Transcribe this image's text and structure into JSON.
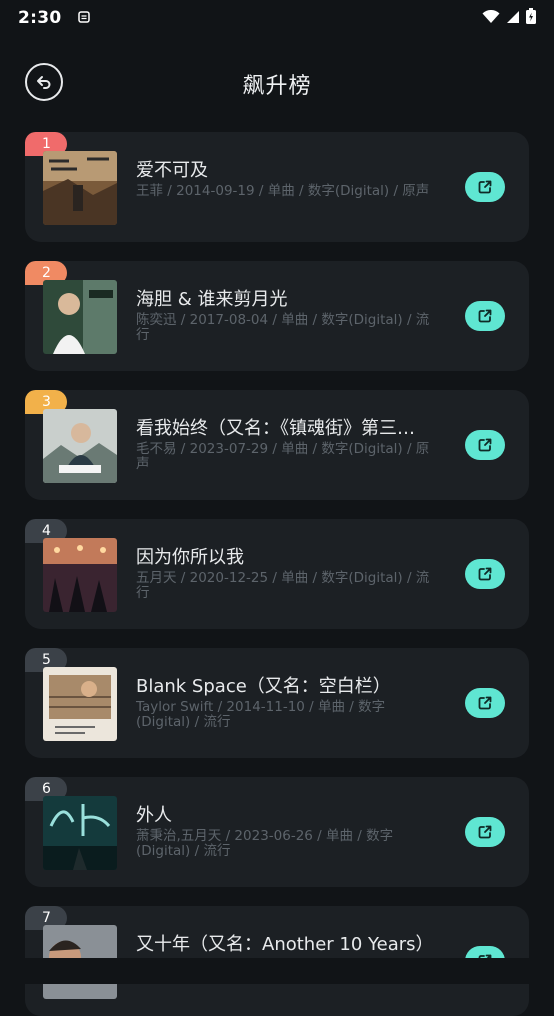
{
  "status": {
    "time": "2:30"
  },
  "header": {
    "title": "飙升榜"
  },
  "songs": [
    {
      "rank": "1",
      "title": "爱不可及",
      "meta": "王菲 / 2014-09-19 / 单曲 / 数字(Digital) / 原声"
    },
    {
      "rank": "2",
      "title": "海胆 & 谁来剪月光",
      "meta": "陈奕迅 / 2017-08-04 / 单曲 / 数字(Digital) / 流行"
    },
    {
      "rank": "3",
      "title": "看我始终（又名：《镇魂街》第三…",
      "meta": "毛不易 / 2023-07-29 / 单曲 / 数字(Digital) / 原声"
    },
    {
      "rank": "4",
      "title": "因为你所以我",
      "meta": "五月天 / 2020-12-25 / 单曲 / 数字(Digital) / 流行"
    },
    {
      "rank": "5",
      "title": "Blank Space（又名：空白栏）",
      "meta": "Taylor Swift / 2014-11-10 / 单曲 / 数字(Digital) / 流行"
    },
    {
      "rank": "6",
      "title": "外人",
      "meta": "萧秉治,五月天 / 2023-06-26 / 单曲 / 数字(Digital) / 流行"
    },
    {
      "rank": "7",
      "title": "又十年（又名：Another 10 Years）",
      "meta": ""
    }
  ],
  "colors": {
    "accent": "#5fe6d2",
    "rank1": "#f06b6b",
    "rank2": "#f08a63",
    "rank3": "#f2b14a",
    "card": "#1c2024"
  }
}
